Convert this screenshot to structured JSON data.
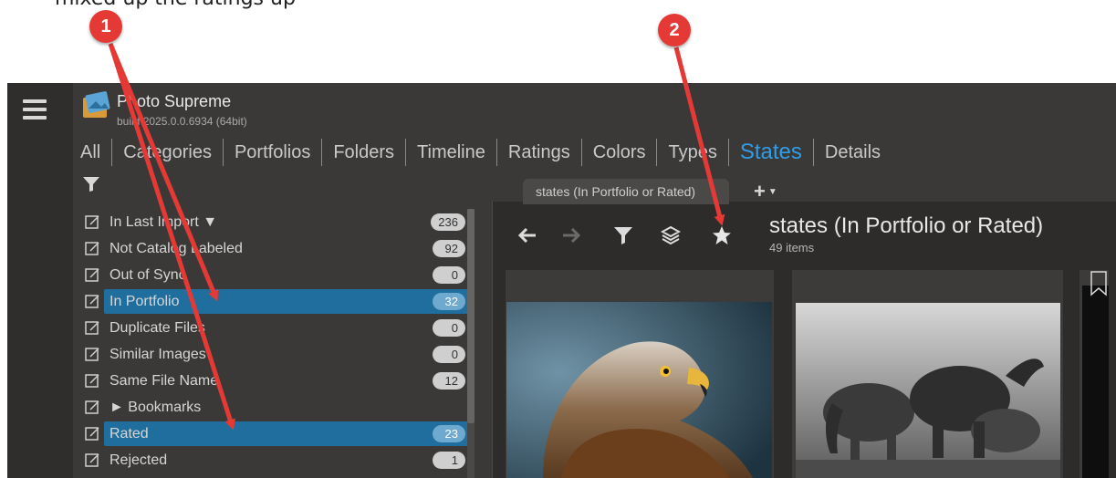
{
  "caption": {
    "text": "mixed up the ratings up "
  },
  "app": {
    "title": "Photo Supreme",
    "build": "build 2025.0.0.6934 (64bit)"
  },
  "nav": {
    "tabs": [
      {
        "label": "All"
      },
      {
        "label": "Categories"
      },
      {
        "label": "Portfolios"
      },
      {
        "label": "Folders"
      },
      {
        "label": "Timeline"
      },
      {
        "label": "Ratings"
      },
      {
        "label": "Colors"
      },
      {
        "label": "Types"
      },
      {
        "label": "States",
        "active": true
      },
      {
        "label": "Details"
      }
    ]
  },
  "states": {
    "items": [
      {
        "label": "In Last Import ▼",
        "count": "236"
      },
      {
        "label": "Not Catalog Labeled",
        "count": "92"
      },
      {
        "label": "Out of Sync",
        "count": "0"
      },
      {
        "label": "In Portfolio",
        "count": "32",
        "selected": true
      },
      {
        "label": "Duplicate Files",
        "count": "0"
      },
      {
        "label": "Similar Images",
        "count": "0"
      },
      {
        "label": "Same File Name",
        "count": "12"
      },
      {
        "label": "► Bookmarks",
        "count": ""
      },
      {
        "label": "Rated",
        "count": "23",
        "selected": true
      },
      {
        "label": "Rejected",
        "count": "1"
      }
    ]
  },
  "portfolio_tab": {
    "label": "states (In Portfolio or Rated)",
    "add_label": "+"
  },
  "panel": {
    "title": "states (In Portfolio or Rated)",
    "subtitle": "49 items"
  },
  "callouts": {
    "one": "1",
    "two": "2"
  },
  "colors": {
    "accent": "#2f9ee8",
    "selection": "#1f6e9e",
    "callout": "#e53935"
  }
}
